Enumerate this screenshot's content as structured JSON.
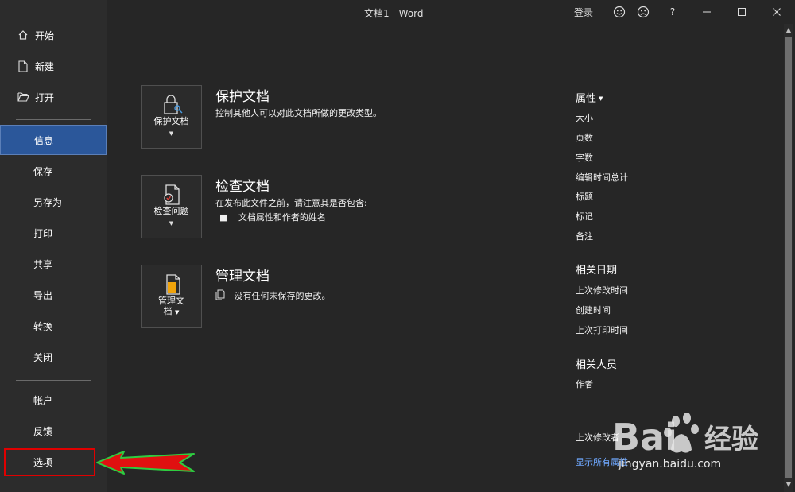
{
  "window": {
    "title": "文档1  -  Word",
    "login": "登录",
    "help": "?",
    "smile_icon": "smile-icon",
    "frown_icon": "frown-icon"
  },
  "sidebar": {
    "top_items": [
      {
        "label": "开始",
        "icon": "home-icon"
      },
      {
        "label": "新建",
        "icon": "new-document-icon"
      },
      {
        "label": "打开",
        "icon": "folder-open-icon"
      }
    ],
    "items": [
      "信息",
      "保存",
      "另存为",
      "打印",
      "共享",
      "导出",
      "转换",
      "关闭"
    ],
    "active_item": "信息",
    "bottom_items": [
      "帐户",
      "反馈",
      "选项"
    ],
    "highlighted_item": "选项"
  },
  "sections": [
    {
      "button_label_1": "保护文档",
      "button_label_2": "",
      "icon": "lock-key-icon",
      "title": "保护文档",
      "description": "控制其他人可以对此文档所做的更改类型。"
    },
    {
      "button_label_1": "检查问题",
      "button_label_2": "",
      "icon": "inspect-document-icon",
      "title": "检查文档",
      "description": "在发布此文件之前，请注意其是否包含:",
      "bullets": [
        "文档属性和作者的姓名"
      ]
    },
    {
      "button_label_1": "管理文",
      "button_label_2": "档",
      "icon": "manage-document-icon",
      "title": "管理文档",
      "description": "没有任何未保存的更改。"
    }
  ],
  "properties": {
    "heading": "属性",
    "items": [
      "大小",
      "页数",
      "字数",
      "编辑时间总计",
      "标题",
      "标记",
      "备注"
    ],
    "dates_heading": "相关日期",
    "dates": [
      "上次修改时间",
      "创建时间",
      "上次打印时间"
    ],
    "people_heading": "相关人员",
    "people": [
      "作者"
    ],
    "last_modified_by": "上次修改者",
    "show_all": "显示所有属性"
  },
  "watermark": {
    "logo_text": "Bai 经验",
    "url": "jingyan.baidu.com"
  },
  "colors": {
    "background": "#262626",
    "sidebar": "#2c2c2c",
    "active": "#2b579a",
    "highlight_box": "#e00000",
    "arrow_fill": "#e01010",
    "arrow_outline": "#2ecc40",
    "link": "#6fa8ff"
  }
}
